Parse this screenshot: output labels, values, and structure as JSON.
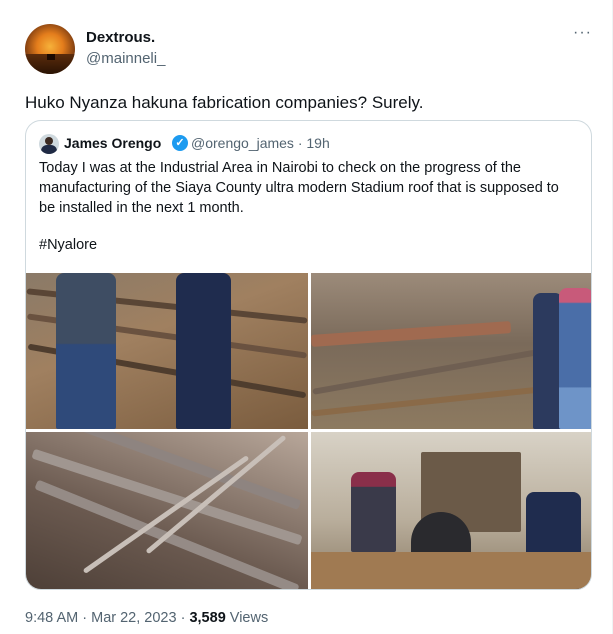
{
  "tweet": {
    "author_name": "Dextrous.",
    "author_handle": "@mainneli_",
    "more_label": "···",
    "text": "Huko Nyanza hakuna fabrication companies? Surely."
  },
  "quote": {
    "author_name": "James Orengo",
    "author_handle": "@orengo_james",
    "separator": "·",
    "time": "19h",
    "verified_mark": "✓",
    "text": "Today I was at the Industrial Area in Nairobi to check on the progress of the manufacturing of the Siaya County ultra modern Stadium roof that is supposed to be installed in the next 1 month.",
    "hashtag": "#Nyalore"
  },
  "footer": {
    "time": "9:48 AM",
    "dot": "·",
    "date": "Mar 22, 2023",
    "views_count": "3,589",
    "views_label": "Views"
  },
  "colors": {
    "link": "#1d9bf0",
    "secondary_text": "#536471",
    "border": "#cfd9de"
  },
  "icons": {
    "verified": "verified-badge-icon",
    "more": "more-options-icon"
  }
}
